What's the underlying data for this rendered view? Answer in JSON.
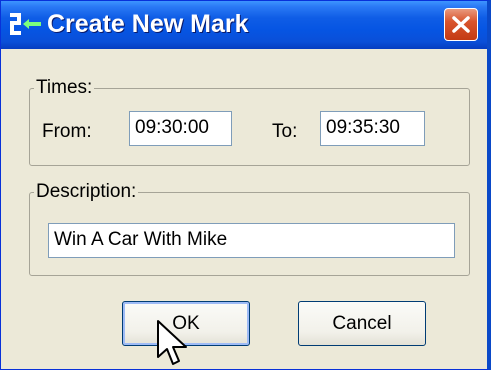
{
  "window": {
    "title": "Create New Mark",
    "close_icon": "close-icon"
  },
  "times": {
    "legend": "Times:",
    "from_label": "From:",
    "from_value": "09:30:00",
    "to_label": "To:",
    "to_value": "09:35:30"
  },
  "description": {
    "legend": "Description:",
    "value": "Win A Car With Mike"
  },
  "buttons": {
    "ok_label": "OK",
    "cancel_label": "Cancel"
  },
  "colors": {
    "titlebar": "#0655e3",
    "dialog_bg": "#ece9d8",
    "close_button": "#d9552d"
  }
}
